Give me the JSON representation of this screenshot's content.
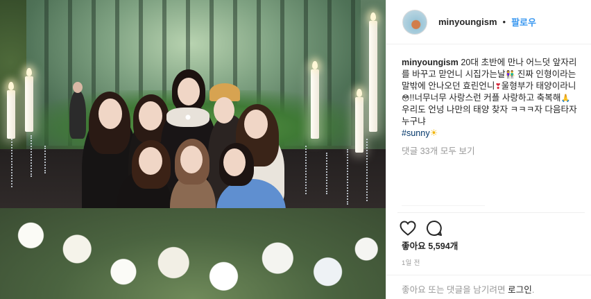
{
  "post": {
    "username": "minyoungism",
    "dot": "•",
    "follow_label": "팔로우",
    "caption": {
      "user": "minyoungism",
      "line1": "20대 초반에 만나 어느덧 앞자리를 바꾸고 맏언니 시집가는날",
      "line2": "진짜 인형이라는 말밖에 안나오던 효린언니",
      "line3": "울형부가 태양이라니",
      "line4": "!!너무너무 사랑스런 커플 사랑하고 축복해",
      "line5": "우리도 언넝 나만의 태양 찾자 ㅋㅋㅋ자 다음타자 누구냐",
      "hashtag": "#sunny"
    },
    "emojis": {
      "couple": "👫",
      "heart": "❣",
      "face": "😳",
      "pray": "🙏",
      "sun": "☀"
    },
    "view_comments": "댓글 33개 모두 보기",
    "likes_label": "좋아요 5,594개",
    "time_ago": "1일 전",
    "login_prompt": "좋아요 또는 댓글을 남기려면",
    "login_link": "로그인",
    "login_suffix": "."
  },
  "colors": {
    "link_blue": "#3897f0",
    "hashtag": "#003569",
    "muted": "#999999",
    "text": "#262626"
  }
}
